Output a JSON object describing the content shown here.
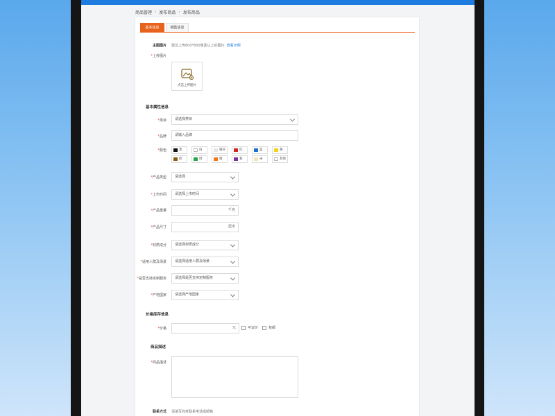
{
  "breadcrumb": [
    "商品管理",
    "发布商品",
    "发布商品"
  ],
  "tabs": [
    {
      "label": "基本信息",
      "active": true
    },
    {
      "label": "销售信息",
      "active": false
    }
  ],
  "main_image": {
    "label": "主图图片",
    "hint": "建议上传800*800像素以上的图片",
    "link": "查看示例"
  },
  "upload": {
    "label": "上传图片",
    "caption": "点击上传图片"
  },
  "basic_section": "基本属性信息",
  "fields": {
    "category": {
      "label": "类目",
      "value": "请选择类目"
    },
    "brand": {
      "label": "品牌",
      "value": "请输入品牌"
    },
    "color_label": "颜色"
  },
  "colors": [
    {
      "name": "黑",
      "hex": "#111111"
    },
    {
      "name": "白",
      "hex": "#ffffff"
    },
    {
      "name": "银灰",
      "hex": "#e6e6e6"
    },
    {
      "name": "红",
      "hex": "#d32424"
    },
    {
      "name": "蓝",
      "hex": "#1f6fc9"
    },
    {
      "name": "黄",
      "hex": "#f2d21b"
    },
    {
      "name": "棕",
      "hex": "#8a5a14"
    },
    {
      "name": "绿",
      "hex": "#27a54a"
    },
    {
      "name": "橙",
      "hex": "#f07b16"
    },
    {
      "name": "紫",
      "hex": "#7b2fa0"
    },
    {
      "name": "米",
      "hex": "#f1e4b4"
    },
    {
      "name": "其他",
      "hex": "#ffffff"
    }
  ],
  "attrs": [
    {
      "label": "产品类型",
      "value": "请选择",
      "kind": "select"
    },
    {
      "label": "上市时间",
      "value": "请选择上市时间",
      "kind": "select"
    },
    {
      "label": "产品重量",
      "value": "",
      "unit": "千克",
      "kind": "input"
    },
    {
      "label": "产品尺寸",
      "value": "",
      "unit": "厘米",
      "kind": "input"
    },
    {
      "label": "材质成分",
      "value": "请选择材质成分",
      "kind": "select"
    },
    {
      "label": "适用人群及场景",
      "value": "请选择适用人群及场景",
      "kind": "select"
    },
    {
      "label": "是否支持定制服务",
      "value": "请选择是否支持定制服务",
      "kind": "select"
    },
    {
      "label": "产地国家",
      "value": "请选择产地国家",
      "kind": "select"
    }
  ],
  "price_section": "价格库存信息",
  "price": {
    "label": "价格",
    "unit": "元",
    "options": [
      "可议价",
      "包邮"
    ]
  },
  "desc_section": "商品描述",
  "desc_label": "商品描述",
  "footer": {
    "label": "联系方式",
    "value": "请填写商家联系电话或邮箱"
  },
  "colors_theme": {
    "accent": "#e8621c",
    "topbar": "#1e7be0",
    "link": "#1e7be0"
  }
}
